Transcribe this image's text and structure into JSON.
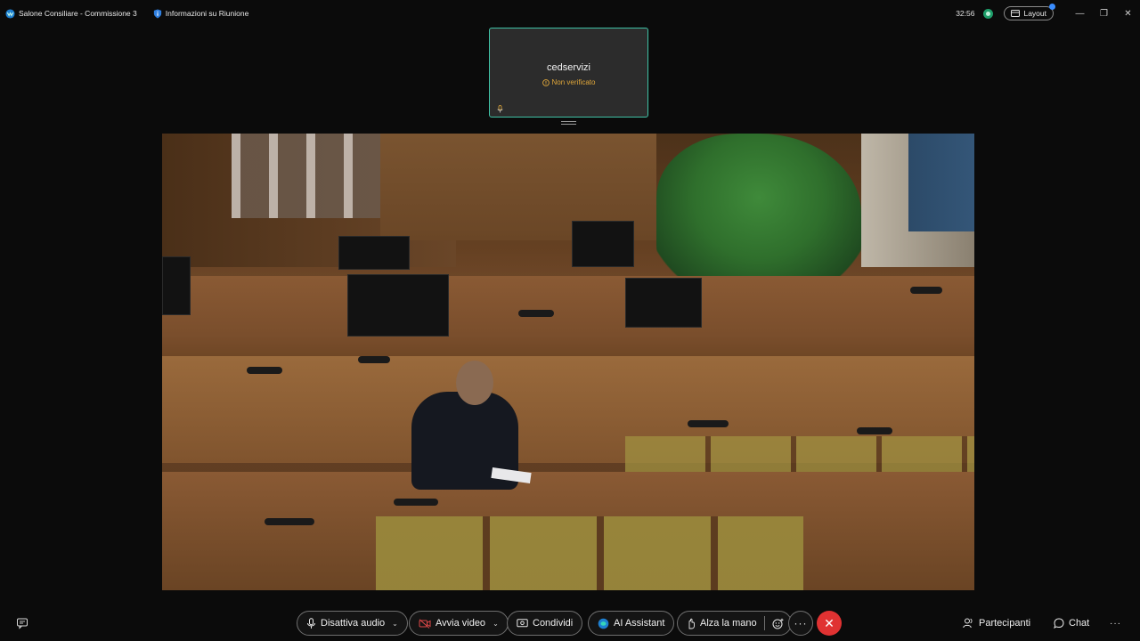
{
  "titlebar": {
    "meeting_title": "Salone Consiliare - Commissione 3",
    "info_label": "Informazioni su Riunione",
    "timer": "32:56",
    "layout_label": "Layout",
    "minimize_glyph": "—",
    "restore_glyph": "❐",
    "close_glyph": "✕"
  },
  "self_preview": {
    "name": "cedservizi",
    "status": "Non verificato",
    "status_color": "#e0a73a",
    "border_color": "#3fc2a6"
  },
  "toolbar": {
    "mute_label": "Disattiva audio",
    "video_label": "Avvia video",
    "share_label": "Condividi",
    "ai_label": "AI Assistant",
    "raise_hand_label": "Alza la mano",
    "more_glyph": "···",
    "end_glyph": "✕",
    "participants_label": "Partecipanti",
    "chat_label": "Chat",
    "overflow_glyph": "···",
    "caret_glyph": "⌄"
  },
  "icons": {
    "app": "webex-icon",
    "info": "shield-info-icon",
    "status": "connection-status-icon",
    "layout": "layout-icon",
    "mic": "microphone-icon",
    "video_off": "video-off-icon",
    "share": "share-screen-icon",
    "ai": "ai-assistant-icon",
    "hand": "raise-hand-icon",
    "reactions": "reactions-icon",
    "participants": "participants-icon",
    "chat": "chat-icon"
  },
  "colors": {
    "accent_teal": "#3fc2a6",
    "end_call_red": "#e03232",
    "status_green": "#1e9e6a",
    "badge_blue": "#3a8dff"
  }
}
